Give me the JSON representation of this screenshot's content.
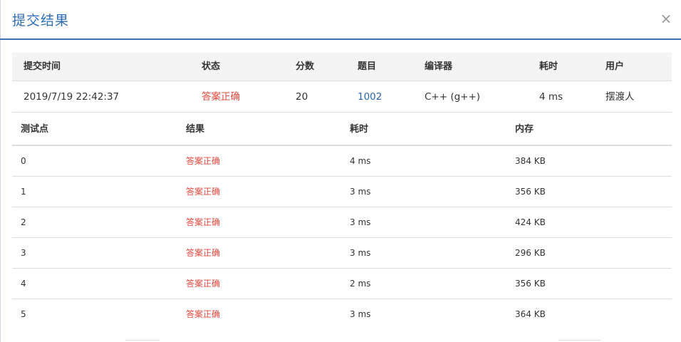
{
  "dialog": {
    "title": "提交结果",
    "close_icon": "×"
  },
  "summary": {
    "headers": [
      "提交时间",
      "状态",
      "分数",
      "题目",
      "编译器",
      "耗时",
      "用户"
    ],
    "row": {
      "submit_time": "2019/7/19 22:42:37",
      "status": "答案正确",
      "score": "20",
      "problem": "1002",
      "compiler": "C++ (g++)",
      "time": "4 ms",
      "user": "摆渡人"
    }
  },
  "testcases": {
    "headers": [
      "测试点",
      "结果",
      "耗时",
      "内存"
    ],
    "rows": [
      {
        "id": "0",
        "result": "答案正确",
        "time": "4 ms",
        "memory": "384 KB"
      },
      {
        "id": "1",
        "result": "答案正确",
        "time": "3 ms",
        "memory": "356 KB"
      },
      {
        "id": "2",
        "result": "答案正确",
        "time": "3 ms",
        "memory": "424 KB"
      },
      {
        "id": "3",
        "result": "答案正确",
        "time": "3 ms",
        "memory": "296 KB"
      },
      {
        "id": "4",
        "result": "答案正确",
        "time": "2 ms",
        "memory": "356 KB"
      },
      {
        "id": "5",
        "result": "答案正确",
        "time": "3 ms",
        "memory": "364 KB"
      }
    ]
  },
  "colors": {
    "accent": "#2f6db5",
    "success_text": "#e0483e",
    "link": "#2a64ad",
    "header_bg": "#f4f4f4"
  }
}
